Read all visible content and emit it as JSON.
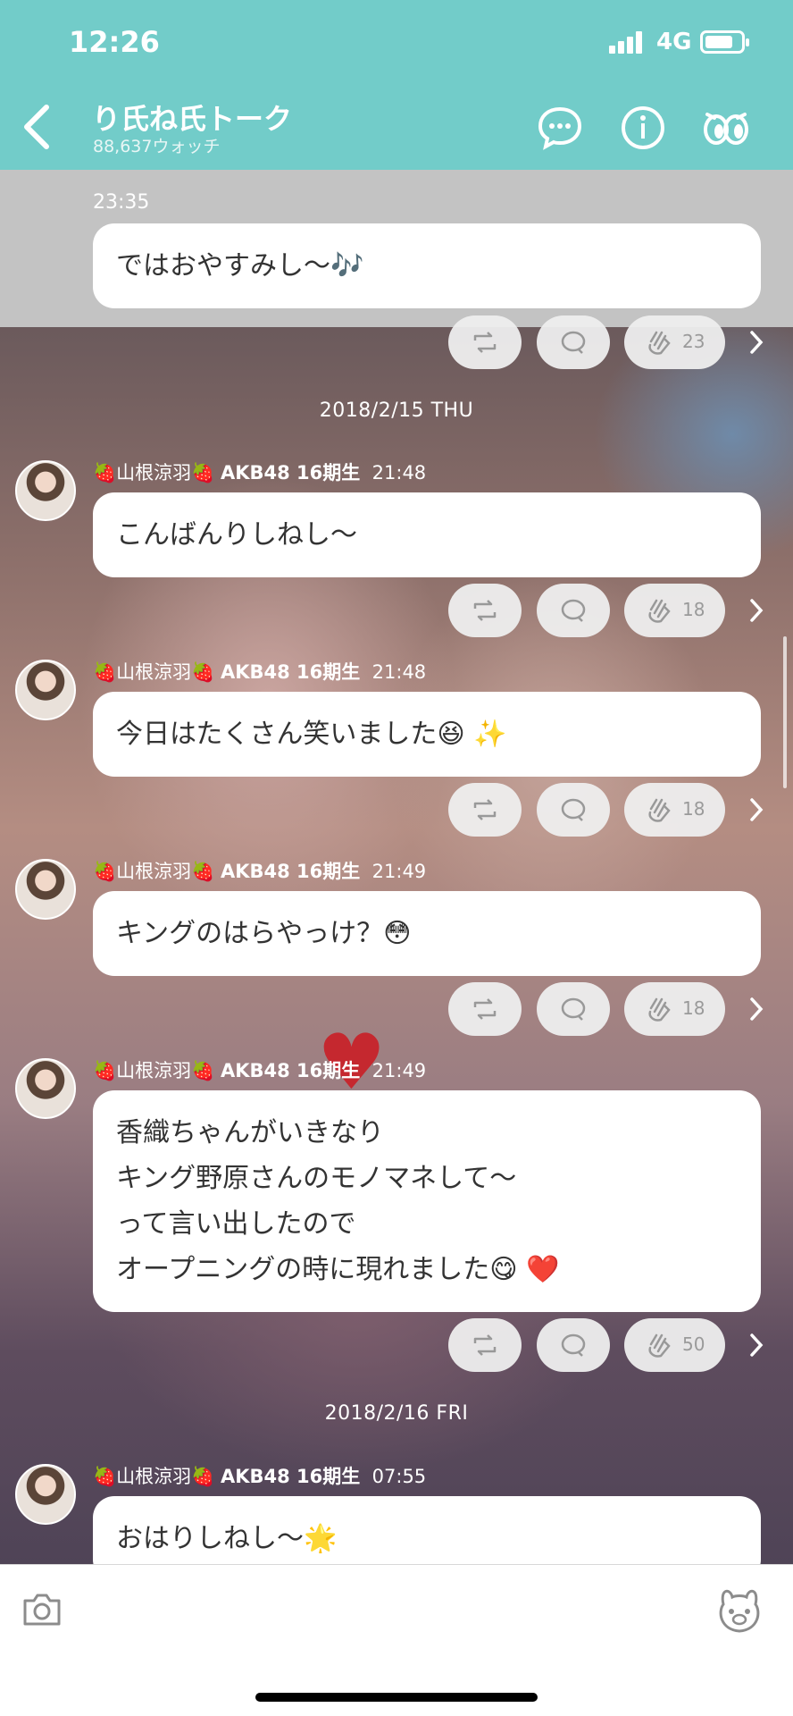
{
  "status": {
    "time": "12:26",
    "network": "4G"
  },
  "header": {
    "title": "り氏ね氏トーク",
    "watch_count": "88,637ウォッチ"
  },
  "chat": {
    "first": {
      "time": "23:35",
      "text": "ではおやすみし〜🎶",
      "clap_count": "23"
    },
    "date1": "2018/2/15 THU",
    "date2": "2018/2/16 FRI",
    "messages": [
      {
        "sender": "🍓山根涼羽🍓",
        "group": "AKB48 16期生",
        "time": "21:48",
        "lines": [
          "こんばんりしねし〜"
        ],
        "clap_count": "18"
      },
      {
        "sender": "🍓山根涼羽🍓",
        "group": "AKB48 16期生",
        "time": "21:48",
        "lines": [
          "今日はたくさん笑いました😆 ✨"
        ],
        "clap_count": "18"
      },
      {
        "sender": "🍓山根涼羽🍓",
        "group": "AKB48 16期生",
        "time": "21:49",
        "lines": [
          "キングのはらやっけ？😳"
        ],
        "clap_count": "18"
      },
      {
        "sender": "🍓山根涼羽🍓",
        "group": "AKB48 16期生",
        "time": "21:49",
        "lines": [
          "香織ちゃんがいきなり",
          "キング野原さんのモノマネして〜",
          "って言い出したので",
          "オープニングの時に現れました😋 ❤️"
        ],
        "clap_count": "50"
      },
      {
        "sender": "🍓山根涼羽🍓",
        "group": "AKB48 16期生",
        "time": "07:55",
        "lines": [
          "おはりしねし〜🌟"
        ]
      }
    ]
  },
  "colors": {
    "header": "#72ccc9",
    "bubble": "#ffffff",
    "pill": "#eeeeee"
  },
  "icons": {
    "back": "chevron-left-icon",
    "comment": "speech-bubble-icon",
    "info": "info-icon",
    "watch": "eyes-icon",
    "repost": "repost-icon",
    "reply": "reply-icon",
    "clap": "clap-icon",
    "more": "chevron-right-icon",
    "camera": "camera-icon",
    "sticker": "bear-icon"
  }
}
